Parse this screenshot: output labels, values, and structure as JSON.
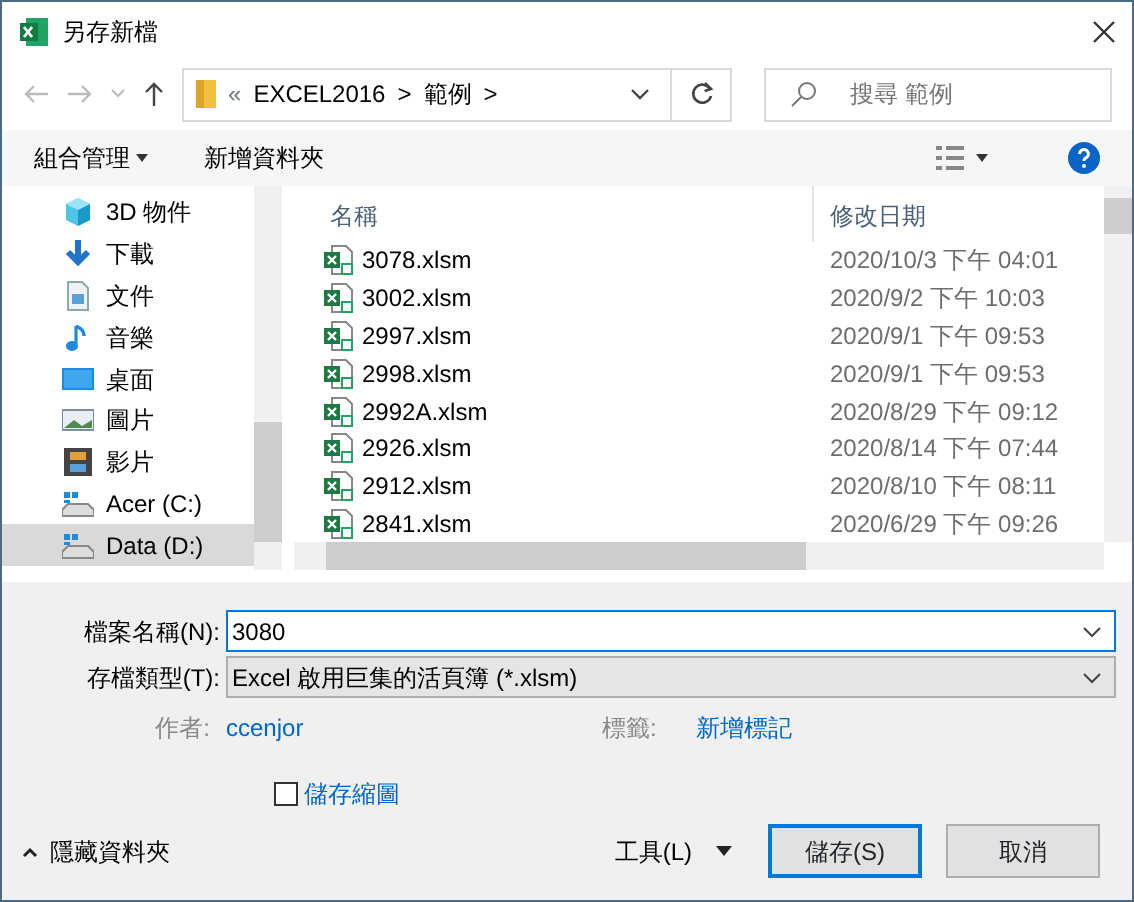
{
  "window": {
    "title": "另存新檔"
  },
  "address": {
    "overflow": "«",
    "path": [
      "EXCEL2016",
      "範例"
    ],
    "separator": ">"
  },
  "search": {
    "placeholder": "搜尋 範例"
  },
  "toolbar": {
    "organize": "組合管理",
    "new_folder": "新增資料夾"
  },
  "sidebar": {
    "items": [
      {
        "label": "3D 物件",
        "kind": "cube",
        "selected": false
      },
      {
        "label": "下載",
        "kind": "download",
        "selected": false
      },
      {
        "label": "文件",
        "kind": "document",
        "selected": false
      },
      {
        "label": "音樂",
        "kind": "music",
        "selected": false
      },
      {
        "label": "桌面",
        "kind": "desktop",
        "selected": false
      },
      {
        "label": "圖片",
        "kind": "pictures",
        "selected": false
      },
      {
        "label": "影片",
        "kind": "videos",
        "selected": false
      },
      {
        "label": "Acer (C:)",
        "kind": "drive",
        "selected": false
      },
      {
        "label": "Data (D:)",
        "kind": "drive",
        "selected": true
      }
    ]
  },
  "table": {
    "columns": [
      "名稱",
      "修改日期"
    ],
    "rows": [
      {
        "name": "3078.xlsm",
        "modified": "2020/10/3 下午 04:01"
      },
      {
        "name": "3002.xlsm",
        "modified": "2020/9/2 下午 10:03"
      },
      {
        "name": "2997.xlsm",
        "modified": "2020/9/1 下午 09:53"
      },
      {
        "name": "2998.xlsm",
        "modified": "2020/9/1 下午 09:53"
      },
      {
        "name": "2992A.xlsm",
        "modified": "2020/8/29 下午 09:12"
      },
      {
        "name": "2926.xlsm",
        "modified": "2020/8/14 下午 07:44"
      },
      {
        "name": "2912.xlsm",
        "modified": "2020/8/10 下午 08:11"
      },
      {
        "name": "2841.xlsm",
        "modified": "2020/6/29 下午 09:26"
      }
    ]
  },
  "form": {
    "filename_label": "檔案名稱(N):",
    "filename": "3080",
    "type_label": "存檔類型(T):",
    "type": "Excel 啟用巨集的活頁簿 (*.xlsm)",
    "author_label": "作者:",
    "author": "ccenjor",
    "tags_label": "標籤:",
    "tags": "新增標記",
    "thumbnail_label": "儲存縮圖",
    "thumbnail_checked": false
  },
  "footer": {
    "hide_folders": "隱藏資料夾",
    "tools": "工具(L)",
    "save": "儲存(S)",
    "cancel": "取消"
  }
}
